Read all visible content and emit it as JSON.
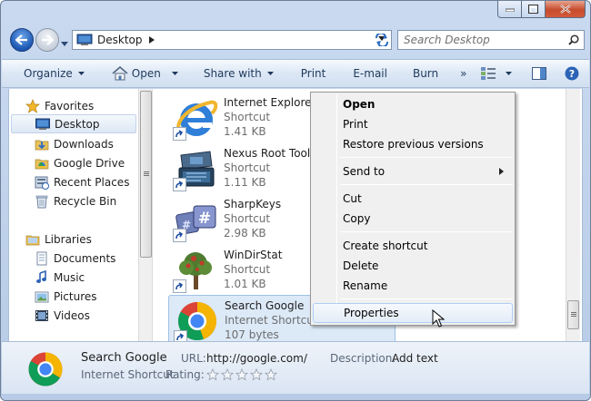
{
  "address": {
    "location": "Desktop"
  },
  "search": {
    "placeholder": "Search Desktop"
  },
  "toolbar": {
    "organize": "Organize",
    "open": "Open",
    "share_with": "Share with",
    "print": "Print",
    "email": "E-mail",
    "burn": "Burn",
    "more": "»"
  },
  "nav": {
    "favorites": "Favorites",
    "desktop": "Desktop",
    "downloads": "Downloads",
    "google_drive": "Google Drive",
    "recent_places": "Recent Places",
    "recycle_bin": "Recycle Bin",
    "libraries": "Libraries",
    "documents": "Documents",
    "music": "Music",
    "pictures": "Pictures",
    "videos": "Videos"
  },
  "files": [
    {
      "name": "Internet Explorer",
      "type": "Shortcut",
      "size": "1.41 KB"
    },
    {
      "name": "Nexus Root Toolkit",
      "type": "Shortcut",
      "size": "1.11 KB"
    },
    {
      "name": "SharpKeys",
      "type": "Shortcut",
      "size": "2.98 KB"
    },
    {
      "name": "WinDirStat",
      "type": "Shortcut",
      "size": "1.01 KB"
    },
    {
      "name": "Search Google",
      "type": "Internet Shortcut",
      "size": "107 bytes"
    }
  ],
  "context_menu": {
    "open": "Open",
    "print": "Print",
    "restore": "Restore previous versions",
    "send_to": "Send to",
    "cut": "Cut",
    "copy": "Copy",
    "create_shortcut": "Create shortcut",
    "delete": "Delete",
    "rename": "Rename",
    "properties": "Properties"
  },
  "details": {
    "name": "Search Google",
    "type": "Internet Shortcut",
    "url_label": "URL:",
    "url_value": "http://google.com/",
    "description_label": "Description:",
    "description_value": "Add text",
    "rating_label": "Rating:",
    "rating_stars": 0,
    "rating_max": 5
  },
  "colors": {
    "frame": "#c9daf0",
    "toolbar_text": "#1e395b",
    "selection": "#dce9f7",
    "close_button": "#c74b2d"
  }
}
